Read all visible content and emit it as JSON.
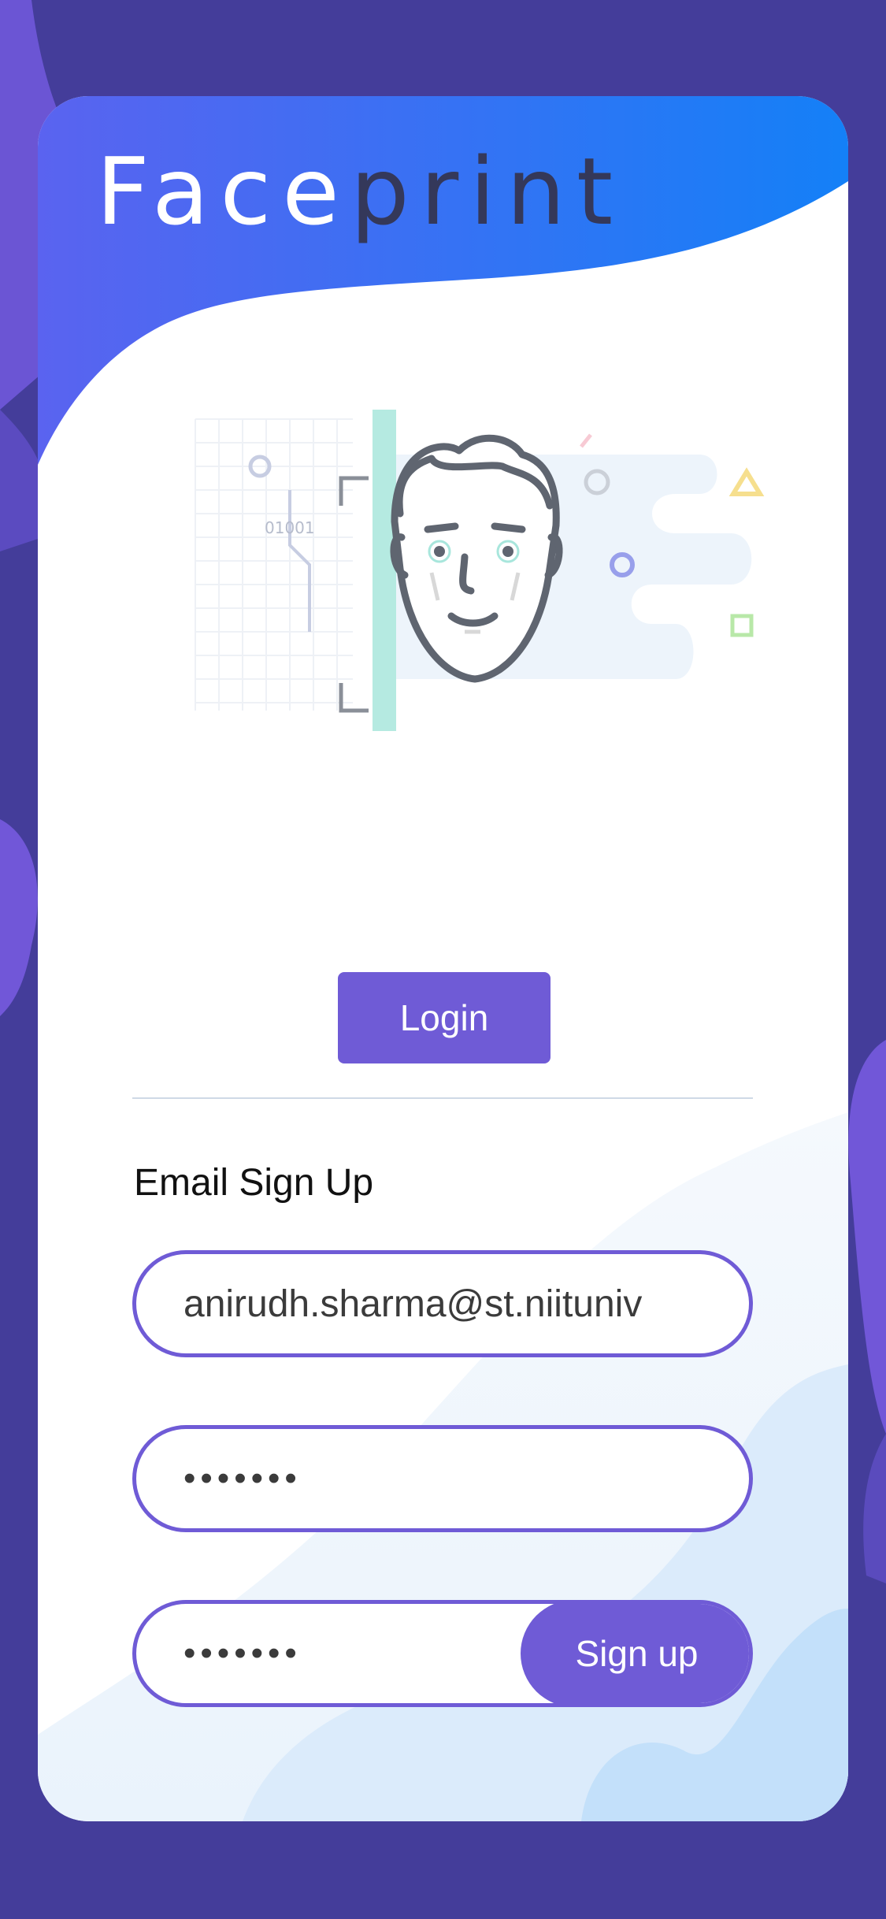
{
  "app": {
    "brand_part1": "Face",
    "brand_part2": "print"
  },
  "login": {
    "button_label": "Login"
  },
  "signup": {
    "title": "Email Sign Up",
    "email_value": "anirudh.sharma@st.niituniv",
    "password_value": "1234567",
    "confirm_value": "1234567",
    "button_label": "Sign up"
  },
  "illustration": {
    "binary_text": "01001"
  },
  "colors": {
    "background": "#443d9a",
    "accent": "#6f5bd6",
    "header_blue": "#1e7bf5",
    "card": "#ffffff"
  }
}
